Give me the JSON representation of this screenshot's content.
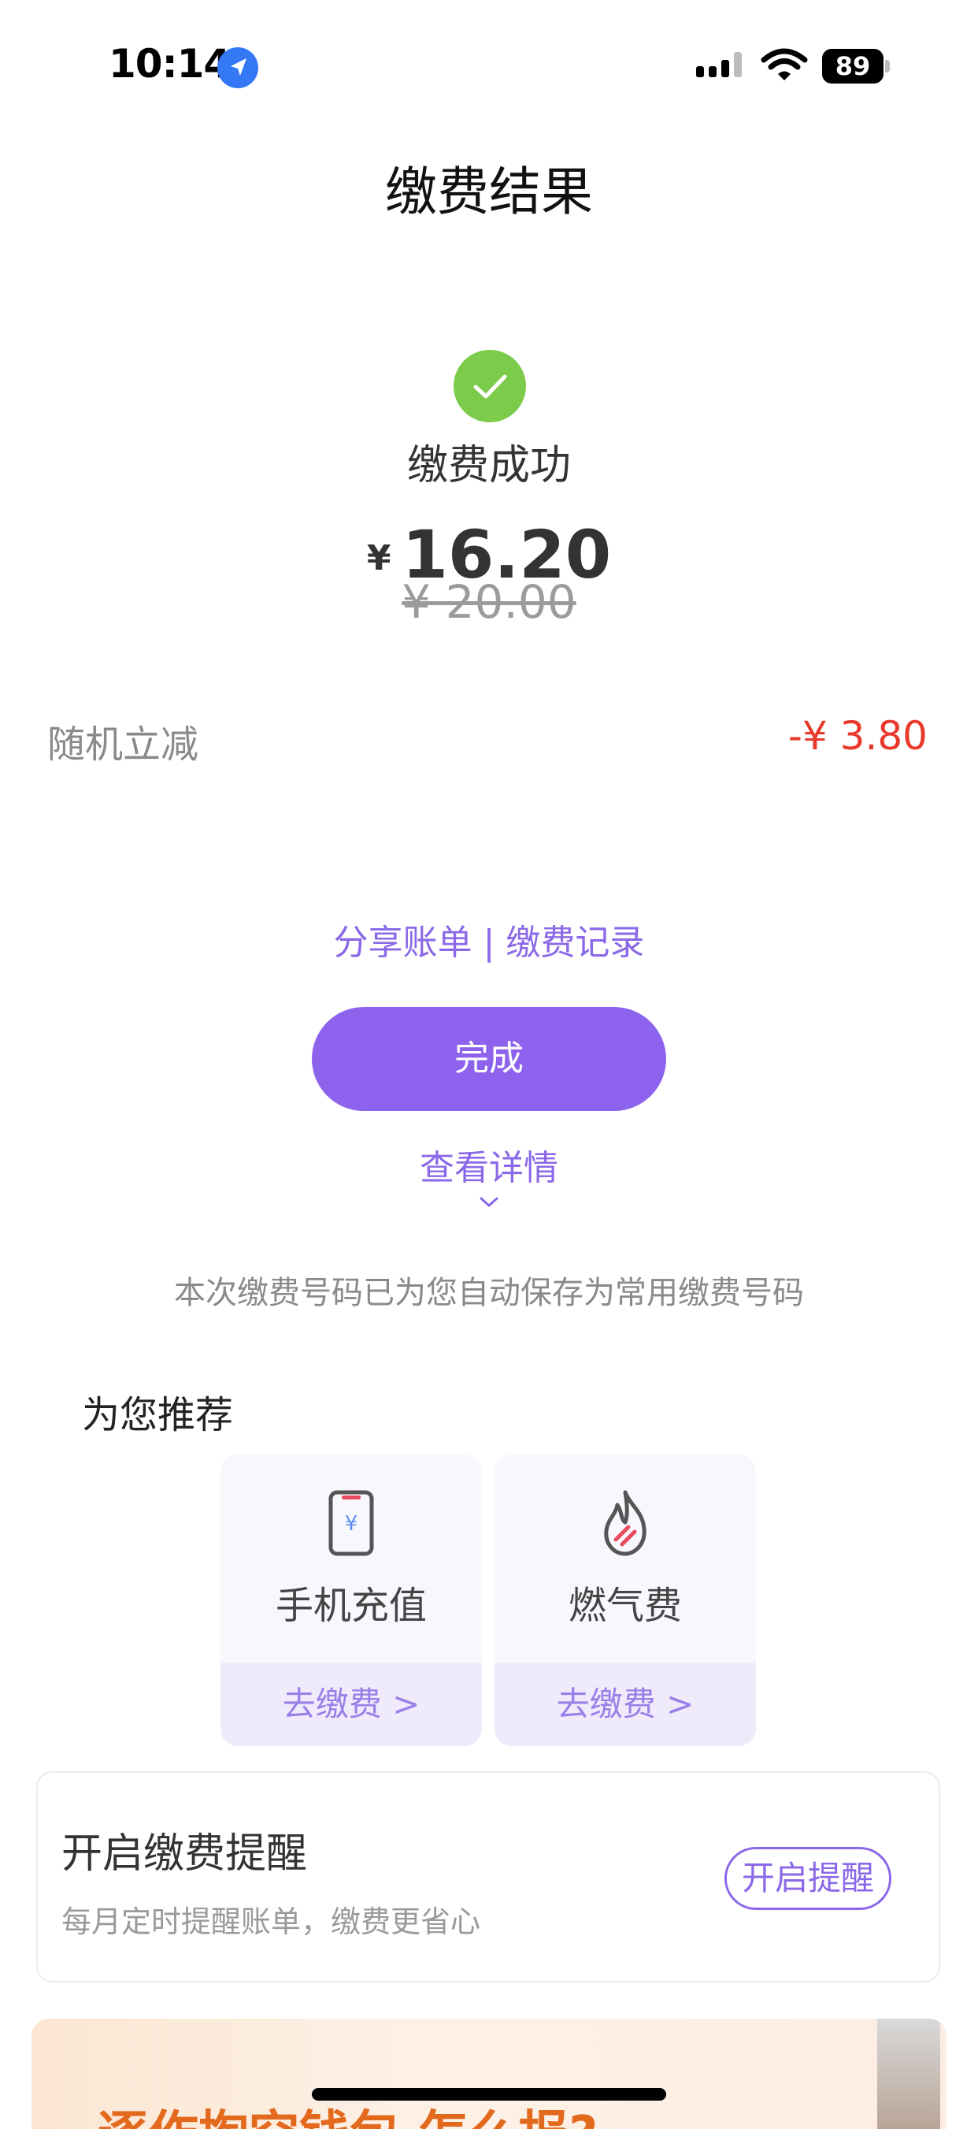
{
  "status_bar": {
    "time": "10:14",
    "battery": "89"
  },
  "header": {
    "title": "缴费结果"
  },
  "result": {
    "status_text": "缴费成功",
    "currency_symbol": "¥",
    "amount": "16.20",
    "original_amount": "¥ 20.00",
    "discount_label": "随机立减",
    "discount_value": "-¥ 3.80"
  },
  "links": {
    "share_bill": "分享账单",
    "separator": " | ",
    "payment_records": "缴费记录"
  },
  "actions": {
    "done_label": "完成",
    "view_details": "查看详情"
  },
  "notice": "本次缴费号码已为您自动保存为常用缴费号码",
  "recommend": {
    "title": "为您推荐",
    "items": [
      {
        "name": "手机充值",
        "action": "去缴费 >",
        "icon": "mobile-recharge-icon"
      },
      {
        "name": "燃气费",
        "action": "去缴费 >",
        "icon": "gas-flame-icon"
      }
    ]
  },
  "reminder": {
    "title": "开启缴费提醒",
    "subtitle": "每月定时提醒账单，缴费更省心",
    "button": "开启提醒"
  },
  "banner": {
    "text": "逐作掏空钱包 怎么报?"
  },
  "colors": {
    "accent": "#8d63ee",
    "success": "#7ccb4a",
    "discount": "#e8392b"
  }
}
